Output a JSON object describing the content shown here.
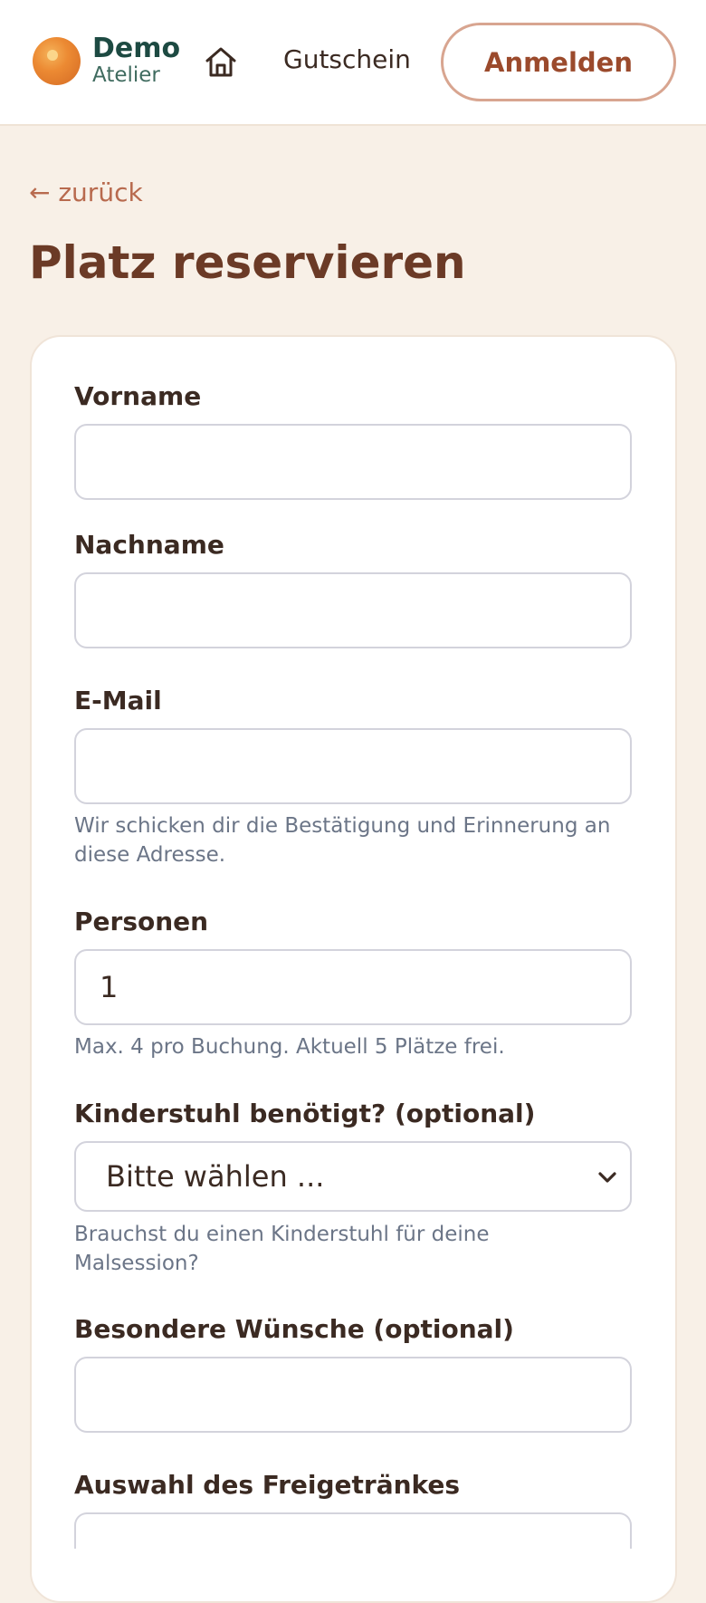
{
  "header": {
    "logo_title": "Demo",
    "logo_subtitle": "Atelier",
    "home_icon": "home-icon",
    "nav_voucher": "Gutschein",
    "login_label": "Anmelden"
  },
  "back_label": "← zurück",
  "page_title": "Platz reservieren",
  "form": {
    "first_name": {
      "label": "Vorname",
      "value": ""
    },
    "last_name": {
      "label": "Nachname",
      "value": ""
    },
    "email": {
      "label": "E-Mail",
      "value": "",
      "hint": "Wir schicken dir die Bestätigung und Erinnerung an diese Adresse."
    },
    "persons": {
      "label": "Personen",
      "value": "1",
      "hint": "Max. 4 pro Buchung. Aktuell 5 Plätze frei."
    },
    "child_chair": {
      "label": "Kinderstuhl benötigt? (optional)",
      "selected": "Bitte wählen ...",
      "hint": "Brauchst du einen Kinderstuhl für deine Malsession?"
    },
    "special_requests": {
      "label": "Besondere Wünsche (optional)",
      "value": ""
    },
    "free_drink": {
      "label": "Auswahl des Freigetränkes"
    }
  },
  "colors": {
    "page_bg": "#f8f0e7",
    "brand_dark_green": "#1d4a42",
    "accent_brown": "#9b4a2c",
    "title_brown": "#6b3a26"
  }
}
